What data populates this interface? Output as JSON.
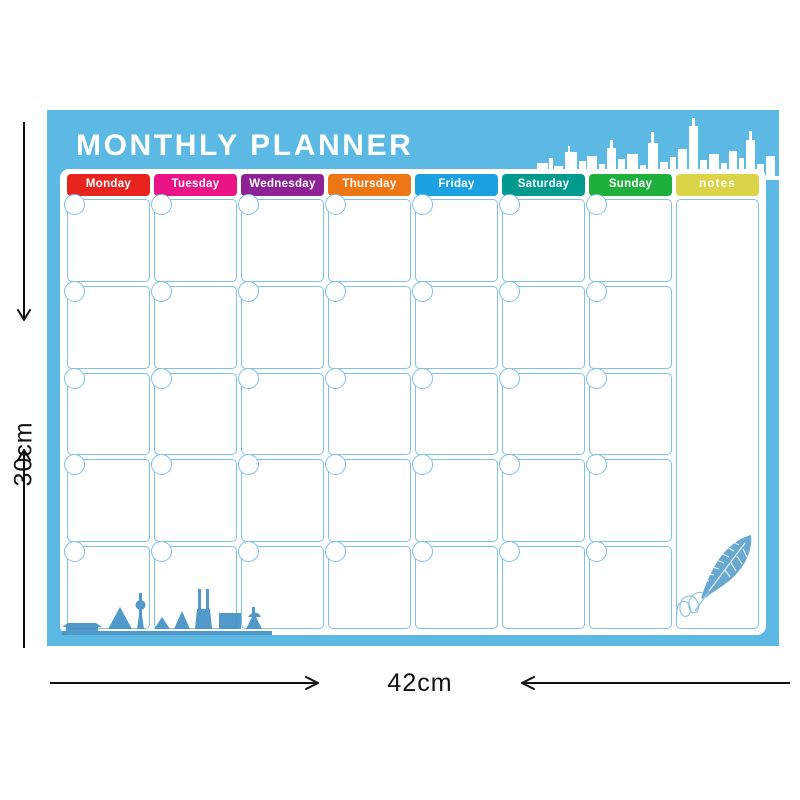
{
  "product": {
    "title": "MONTHLY PLANNER",
    "card_bg_color": "#5bb9e4",
    "sheet_color": "#ffffff",
    "cell_border_color": "#7ec2e4",
    "skyline_top_color": "#ffffff",
    "skyline_bottom_color": "#3f8fc4",
    "feather_color": "#6aa9cf"
  },
  "columns": [
    {
      "label": "Monday",
      "color": "#e8241f",
      "type": "day"
    },
    {
      "label": "Tuesday",
      "color": "#ea1486",
      "type": "day"
    },
    {
      "label": "Wednesday",
      "color": "#8e2196",
      "type": "day"
    },
    {
      "label": "Thursday",
      "color": "#ef7614",
      "type": "day"
    },
    {
      "label": "Friday",
      "color": "#1ba0e2",
      "type": "day"
    },
    {
      "label": "Saturday",
      "color": "#009b8e",
      "type": "day"
    },
    {
      "label": "Sunday",
      "color": "#1faf3c",
      "type": "day"
    },
    {
      "label": "notes",
      "color": "#dbd449",
      "type": "notes"
    }
  ],
  "grid": {
    "rows": 5,
    "day_columns": 7,
    "date_circle_icon": "date-circle"
  },
  "dimensions": {
    "height_label": "30cm",
    "width_label": "42cm",
    "vertical_arrow_icon": "double-arrow-vertical",
    "horizontal_arrow_icon": "double-arrow-horizontal"
  }
}
